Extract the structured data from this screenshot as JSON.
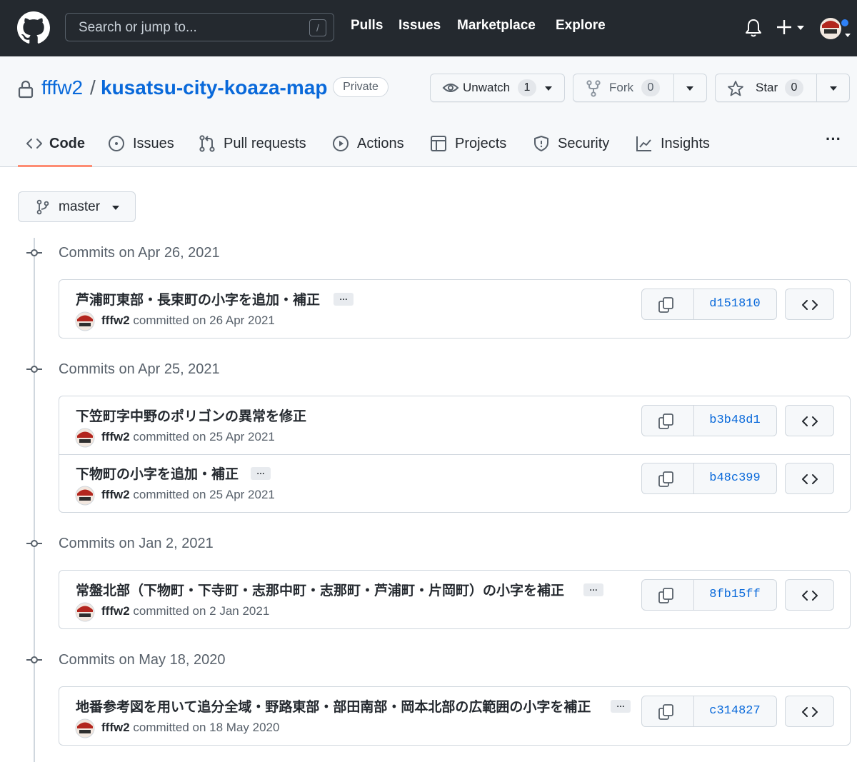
{
  "header": {
    "search_placeholder": "Search or jump to...",
    "search_shortcut": "/",
    "nav": [
      "Pulls",
      "Issues",
      "Marketplace",
      "Explore"
    ],
    "icons": [
      "github-logo",
      "bell-icon",
      "plus-icon",
      "avatar"
    ]
  },
  "repo": {
    "owner": "fffw2",
    "separator": "/",
    "name": "kusatsu-city-koaza-map",
    "visibility": "Private",
    "watch": {
      "label": "Unwatch",
      "count": "1"
    },
    "fork": {
      "label": "Fork",
      "count": "0"
    },
    "star": {
      "label": "Star",
      "count": "0"
    }
  },
  "tabs": [
    {
      "label": "Code",
      "icon": "code-icon",
      "active": true
    },
    {
      "label": "Issues",
      "icon": "issue-icon"
    },
    {
      "label": "Pull requests",
      "icon": "pull-request-icon"
    },
    {
      "label": "Actions",
      "icon": "play-icon"
    },
    {
      "label": "Projects",
      "icon": "table-icon"
    },
    {
      "label": "Security",
      "icon": "shield-icon"
    },
    {
      "label": "Insights",
      "icon": "graph-icon"
    }
  ],
  "more_label": "···",
  "branch": {
    "name": "master"
  },
  "commit_groups": [
    {
      "title": "Commits on Apr 26, 2021",
      "commits": [
        {
          "message": "芦浦町東部・長束町の小字を追加・補正",
          "has_more": true,
          "author": "fffw2",
          "committed_text": "committed on 26 Apr 2021",
          "sha": "d151810"
        }
      ]
    },
    {
      "title": "Commits on Apr 25, 2021",
      "commits": [
        {
          "message": "下笠町字中野のポリゴンの異常を修正",
          "has_more": false,
          "author": "fffw2",
          "committed_text": "committed on 25 Apr 2021",
          "sha": "b3b48d1"
        },
        {
          "message": "下物町の小字を追加・補正",
          "has_more": true,
          "author": "fffw2",
          "committed_text": "committed on 25 Apr 2021",
          "sha": "b48c399"
        }
      ]
    },
    {
      "title": "Commits on Jan 2, 2021",
      "commits": [
        {
          "message": "常盤北部（下物町・下寺町・志那中町・志那町・芦浦町・片岡町）の小字を補正",
          "has_more": true,
          "author": "fffw2",
          "committed_text": "committed on 2 Jan 2021",
          "sha": "8fb15ff"
        }
      ]
    },
    {
      "title": "Commits on May 18, 2020",
      "commits": [
        {
          "message": "地番参考図を用いて追分全域・野路東部・部田南部・岡本北部の広範囲の小字を補正",
          "has_more": true,
          "author": "fffw2",
          "committed_text": "committed on 18 May 2020",
          "sha": "c314827"
        }
      ]
    }
  ],
  "ellipsis_label": "…",
  "colors": {
    "header_bg": "#24292f",
    "link": "#0969da",
    "active_tab": "#fd8c73",
    "border": "#d0d7de"
  }
}
